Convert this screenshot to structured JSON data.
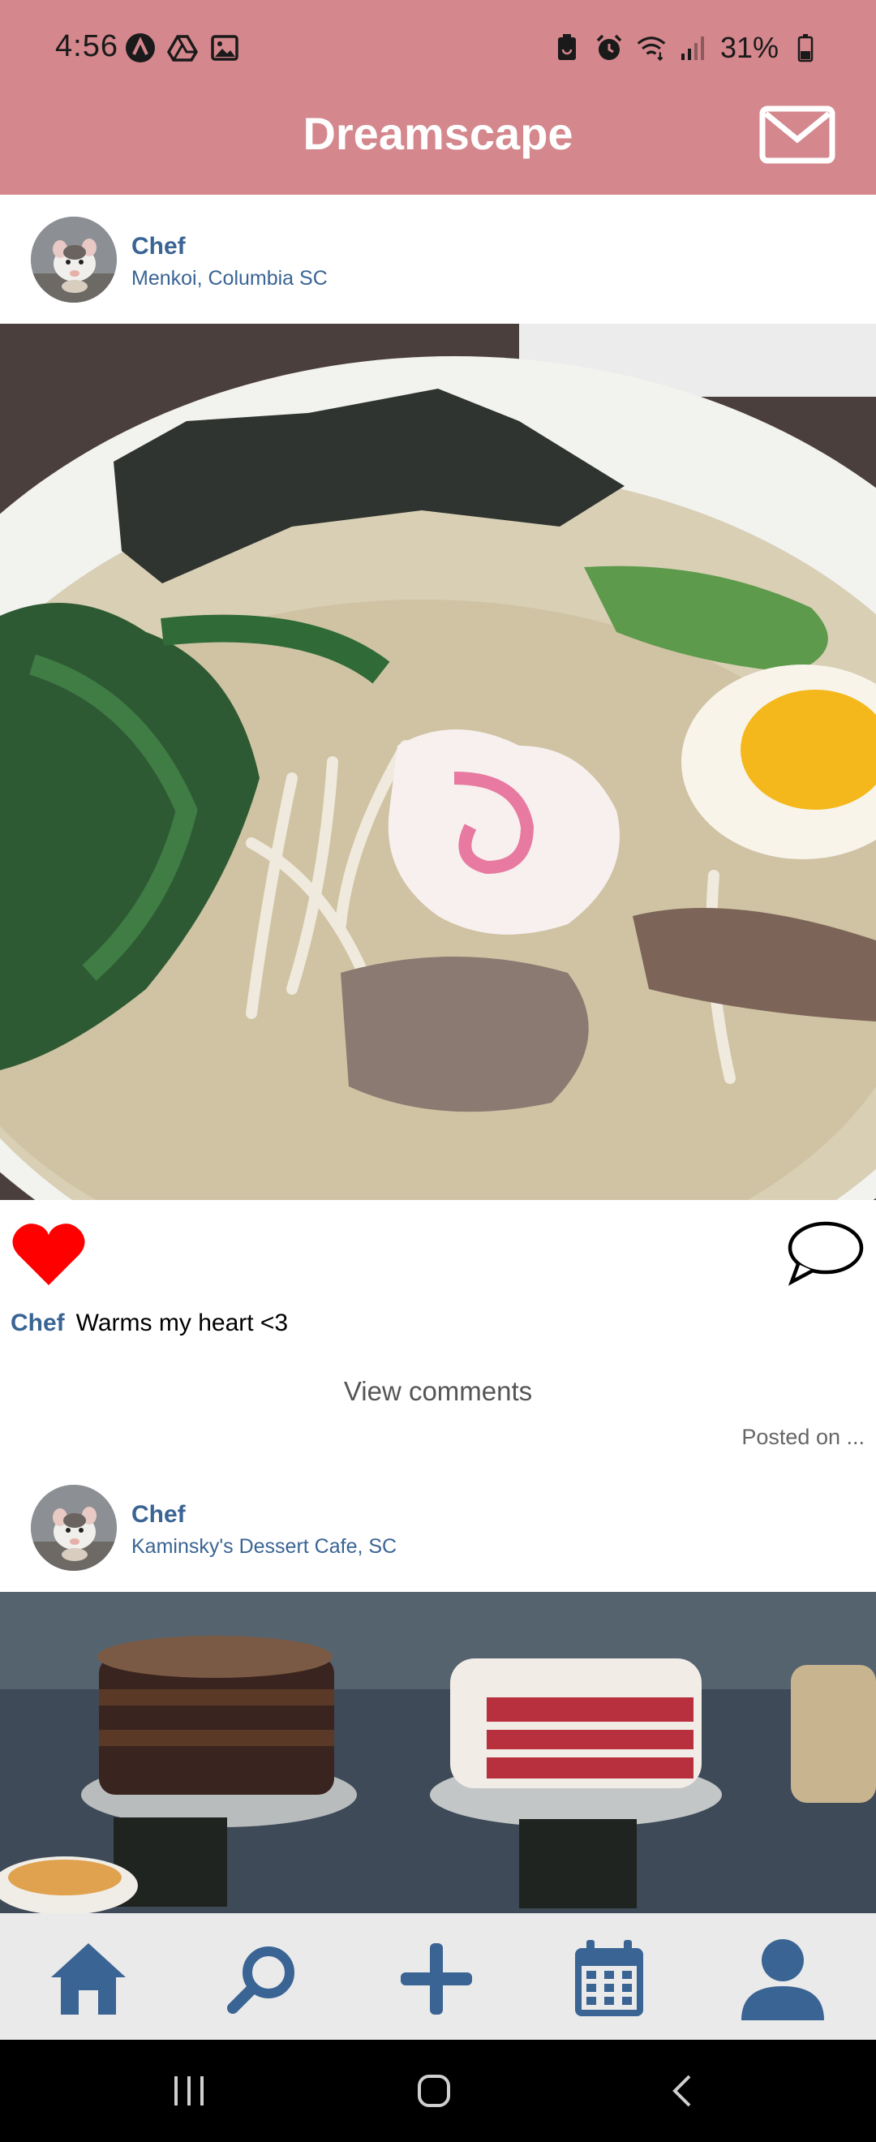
{
  "status_bar": {
    "time": "4:56",
    "battery": "31%",
    "left_icons": [
      "notification-a-icon",
      "drive-icon",
      "image-icon"
    ],
    "right_icons": [
      "battery-saver-icon",
      "alarm-icon",
      "wifi-icon",
      "signal-icon",
      "battery-icon"
    ]
  },
  "app_bar": {
    "title": "Dreamscape",
    "messages_icon": "mail-icon"
  },
  "colors": {
    "app_bar": "#d4878c",
    "accent": "#3a6494",
    "like": "#ff0000",
    "nav_bg": "#eaeaea"
  },
  "feed": {
    "posts": [
      {
        "username": "Chef",
        "location": "Menkoi, Columbia SC",
        "photo": "ramen bowl photo",
        "liked": true,
        "caption_user": "Chef",
        "caption_text": "Warms my heart <3",
        "view_comments": "View comments",
        "posted_on": "Posted on ..."
      },
      {
        "username": "Chef",
        "location": "Kaminsky's Dessert Cafe, SC",
        "photo": "dessert case photo"
      }
    ]
  },
  "bottom_nav": {
    "items": [
      {
        "icon": "home-icon"
      },
      {
        "icon": "search-icon"
      },
      {
        "icon": "add-icon"
      },
      {
        "icon": "calendar-icon"
      },
      {
        "icon": "profile-icon"
      }
    ]
  },
  "system_nav": {
    "items": [
      "recents-icon",
      "home-circle-icon",
      "back-icon"
    ]
  }
}
